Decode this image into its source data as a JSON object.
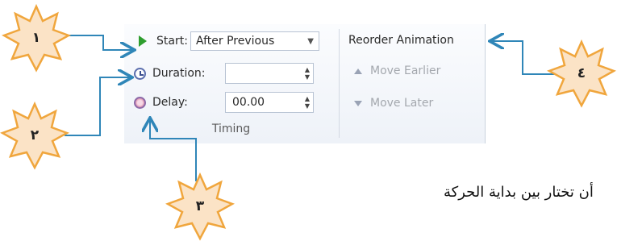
{
  "timing": {
    "start_label": "Start:",
    "start_value": "After Previous",
    "duration_label": "Duration:",
    "duration_value": "",
    "delay_label": "Delay:",
    "delay_value": "00.00",
    "group_label": "Timing"
  },
  "reorder": {
    "title": "Reorder Animation",
    "move_earlier": "Move Earlier",
    "move_later": "Move Later"
  },
  "callouts": {
    "one": "١",
    "two": "٢",
    "three": "٣",
    "four": "٤"
  },
  "caption": "أن تختار بين بداية الحركة",
  "colors": {
    "badge_fill": "#fbe3c6",
    "badge_stroke": "#f0a63d",
    "arrow": "#2f86b8"
  },
  "icons": {
    "start": "play-icon",
    "duration": "clock-icon",
    "delay": "delay-clock-icon"
  }
}
